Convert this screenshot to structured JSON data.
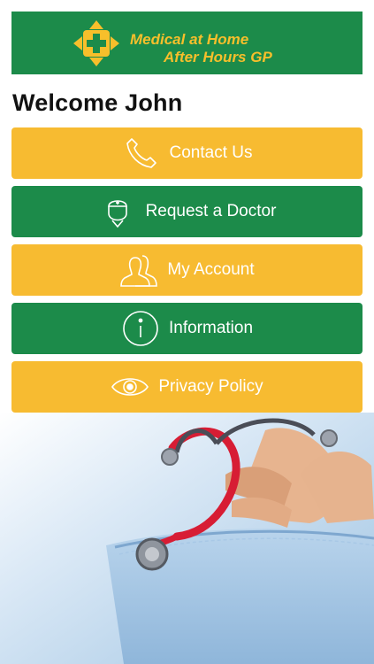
{
  "brand": {
    "line1": "Medical at Home",
    "line2": "After Hours GP",
    "logo_icon": "medical-cross-logo-icon"
  },
  "welcome": "Welcome John",
  "menu": [
    {
      "label": "Contact Us",
      "icon": "phone-icon",
      "color": "#f7bb31"
    },
    {
      "label": "Request a Doctor",
      "icon": "doctor-icon",
      "color": "#1c8b4a"
    },
    {
      "label": "My Account",
      "icon": "users-icon",
      "color": "#f7bb31"
    },
    {
      "label": "Information",
      "icon": "info-icon",
      "color": "#1c8b4a"
    },
    {
      "label": "Privacy Policy",
      "icon": "eye-icon",
      "color": "#f7bb31"
    }
  ],
  "colors": {
    "green": "#1c8b4a",
    "yellow": "#f7bb31",
    "brand_text": "#f7bf2b"
  }
}
